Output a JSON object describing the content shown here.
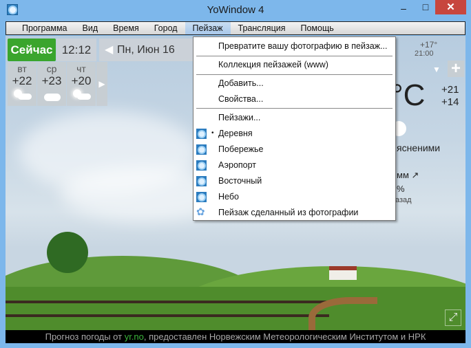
{
  "window": {
    "title": "YoWindow 4",
    "minimize": "–",
    "maximize": "□",
    "close": "✕"
  },
  "menubar": [
    "Программа",
    "Вид",
    "Время",
    "Город",
    "Пейзаж",
    "Трансляция",
    "Помощь"
  ],
  "active_menu": "Пейзаж",
  "now": {
    "label": "Сейчас",
    "time": "12:12",
    "date": "Пн, Июн 16"
  },
  "forecast": [
    {
      "day": "вт",
      "temp": "+22",
      "icon": "partly-cloudy-icon"
    },
    {
      "day": "ср",
      "temp": "+23",
      "icon": "cloud-icon"
    },
    {
      "day": "чт",
      "temp": "+20",
      "icon": "partly-cloudy-icon"
    }
  ],
  "right_panel": {
    "hour_temp": "+17°",
    "hour_time": "21:00",
    "temp_unit": "°C",
    "high": "+21",
    "low": "+14",
    "desc_fragment": "ясненими",
    "precip_fragment": "мм ↗",
    "humidity_fragment": "%",
    "ago_fragment": "азад",
    "add": "+"
  },
  "dropdown": {
    "items": [
      {
        "label": "Превратите вашу фотографию в пейзаж..."
      },
      {
        "label": "Коллекция пейзажей (www)"
      },
      {
        "label": "Добавить..."
      },
      {
        "label": "Свойства..."
      },
      {
        "label": "Пейзажи..."
      },
      {
        "label": "Деревня",
        "selected": true,
        "icon": "yowindow-icon"
      },
      {
        "label": "Побережье",
        "icon": "yowindow-icon"
      },
      {
        "label": "Аэропорт",
        "icon": "yowindow-icon"
      },
      {
        "label": "Восточный",
        "icon": "yowindow-icon"
      },
      {
        "label": "Небо",
        "icon": "yowindow-icon"
      },
      {
        "label": "Пейзаж сделанный из фотографии",
        "icon": "flower-icon"
      }
    ],
    "bullet": "•"
  },
  "footer": {
    "prefix": "Прогноз погоды от ",
    "link": "yr.no",
    "suffix": ", предоставлен Норвежским Метеорологическим Институтом и НРК"
  },
  "colors": {
    "frame": "#7db7eb",
    "now_green": "#3aa52d",
    "close_red": "#c7463e",
    "link_green": "#3bb53b"
  }
}
